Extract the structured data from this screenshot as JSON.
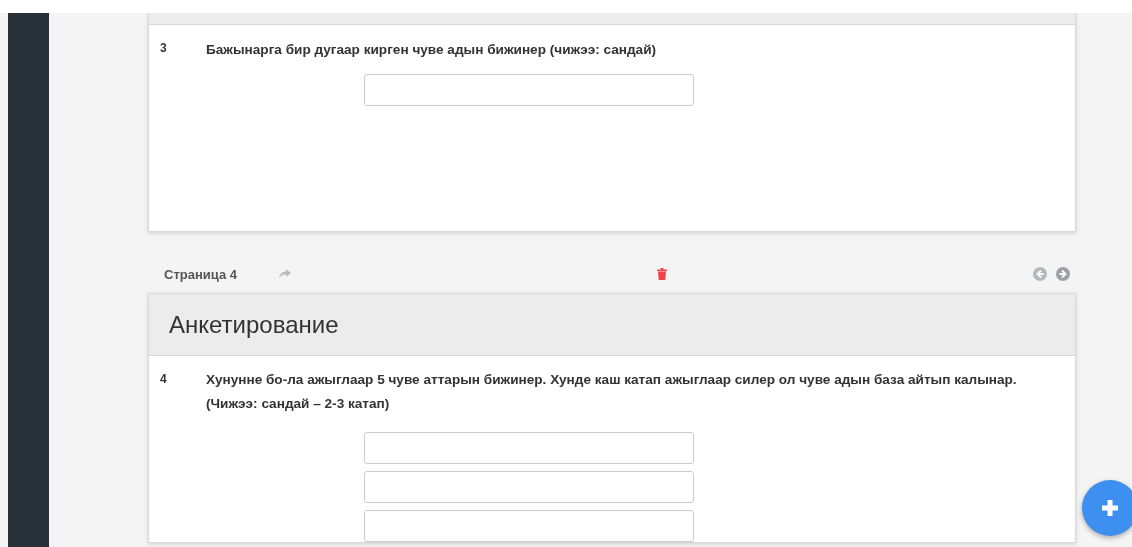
{
  "cards": [
    {
      "questions": [
        {
          "number": "3",
          "text": "Бажынарга бир дугаар кирген чуве адын бижинер (чижээ: сандай)",
          "fields": [
            {
              "kind": "text"
            }
          ]
        }
      ]
    },
    {
      "page": {
        "label": "Страница 4"
      },
      "header": "Анкетирование",
      "questions": [
        {
          "number": "4",
          "text": "Хунунне бо-ла ажыглаар 5 чуве аттарын бижинер. Хунде каш катап ажыглаар силер ол чуве адын база айтып калынар.  (Чижээ: сандай – 2-3 катап)",
          "fields": [
            {
              "kind": "text"
            },
            {
              "kind": "text"
            },
            {
              "kind": "text"
            }
          ]
        }
      ]
    }
  ]
}
